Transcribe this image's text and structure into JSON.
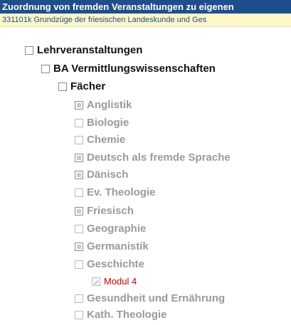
{
  "header": {
    "title": "Zuordnung von fremden Veranstaltungen zu eigenen",
    "course": "331101k  Grundzüge der friesischen Landeskunde und Ges"
  },
  "tree": {
    "root": "Lehrveranstaltungen",
    "program": "BA Vermittlungswissenschaften",
    "group": "Fächer",
    "subjects": [
      "Anglistik",
      "Biologie",
      "Chemie",
      "Deutsch als fremde Sprache",
      "Dänisch",
      "Ev. Theologie",
      "Friesisch",
      "Geographie",
      "Germanistik",
      "Geschichte",
      "Modul 4",
      "Gesundheit und Ernährung",
      "Kath. Theologie"
    ]
  },
  "colors": {
    "title_bg": "#1f4e8c",
    "subbar_bg": "#fdf6c8",
    "selected_text": "#c00000"
  }
}
